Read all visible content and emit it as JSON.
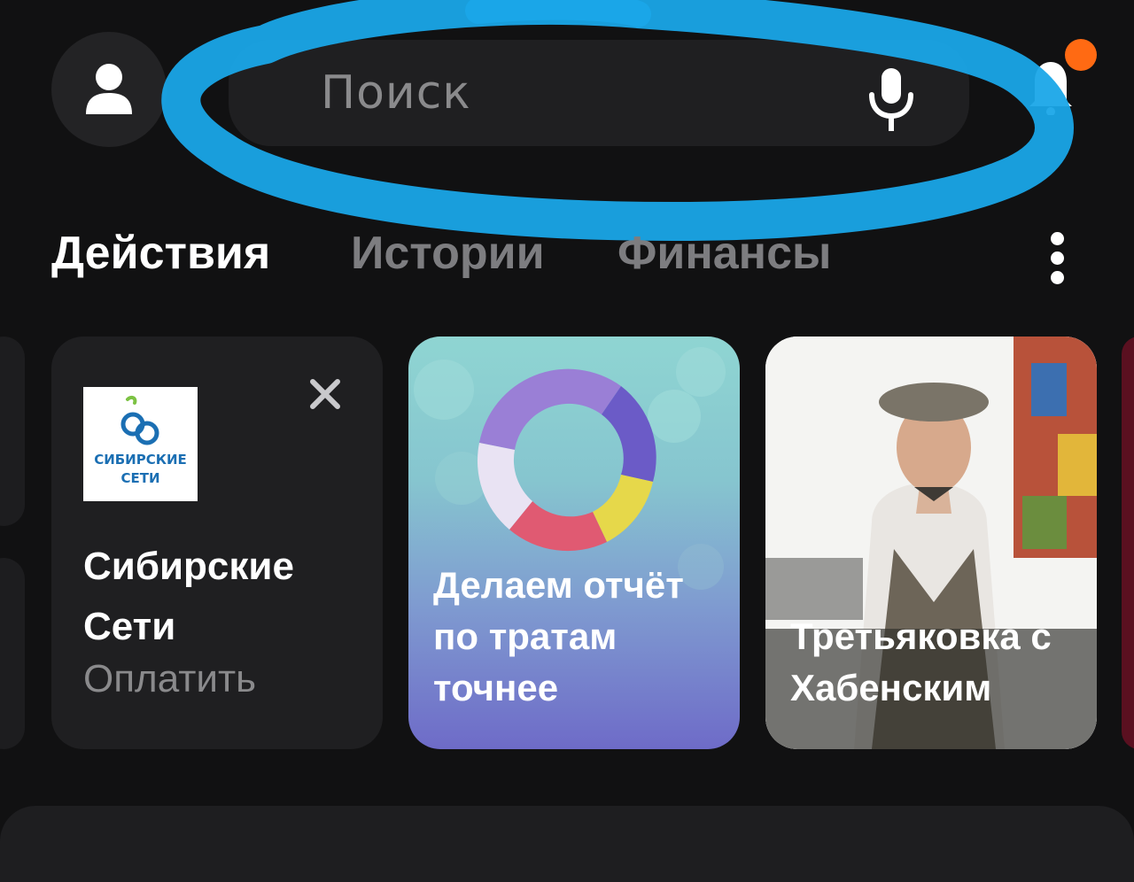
{
  "header": {
    "profile_icon": "user-icon",
    "search": {
      "placeholder": "Поиск",
      "mic_icon": "microphone-icon"
    },
    "notifications": {
      "icon": "bell-icon",
      "badge_color": "#ff6a13"
    }
  },
  "tabs": [
    {
      "label": "Действия",
      "active": true
    },
    {
      "label": "Истории",
      "active": false
    },
    {
      "label": "Финансы",
      "active": false
    }
  ],
  "more_icon": "more-vertical-icon",
  "cards": [
    {
      "logo_text": [
        "СИБИРСКИЕ",
        "СЕТИ"
      ],
      "title": [
        "Сибирские",
        "Сети"
      ],
      "action": "Оплатить",
      "close_icon": "close-icon"
    },
    {
      "text": [
        "Делаем отчёт",
        "по тратам",
        "точнее"
      ]
    },
    {
      "text": [
        "Третьяковка с",
        "Хабенским"
      ]
    }
  ],
  "colors": {
    "background": "#111112",
    "scribble": "#1aa6e8",
    "accent_dot": "#ff6a13"
  }
}
